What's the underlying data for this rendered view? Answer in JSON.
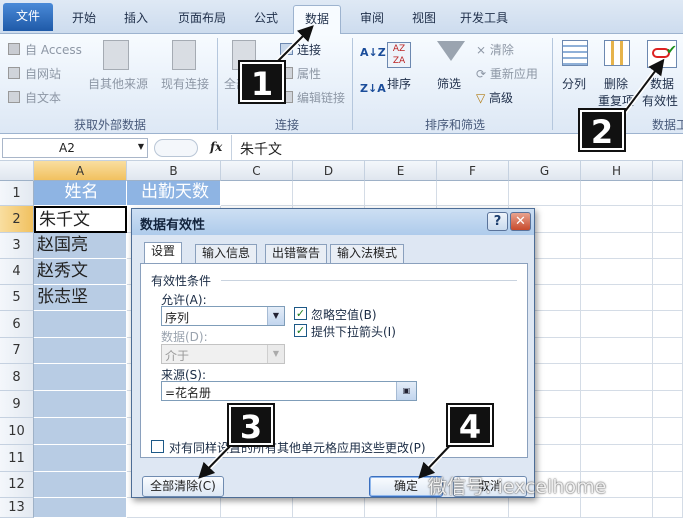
{
  "tabs": [
    "文件",
    "开始",
    "插入",
    "页面布局",
    "公式",
    "数据",
    "审阅",
    "视图",
    "开发工具"
  ],
  "ribbon": {
    "external": {
      "access": "自 Access",
      "web": "自网站",
      "text": "自文本",
      "other": "自其他来源",
      "existing": "现有连接",
      "group": "获取外部数据"
    },
    "connections": {
      "refresh": "全部",
      "conn": "连接",
      "props": "属性",
      "edit_links": "编辑链接",
      "group": "连接"
    },
    "sort": {
      "sort": "排序",
      "filter": "筛选",
      "clear": "清除",
      "reapply": "重新应用",
      "advanced": "高级",
      "group": "排序和筛选"
    },
    "tools": {
      "split": "分列",
      "remove": "删除",
      "duplicates": "重复项",
      "validation": "数据",
      "validity": "有效性",
      "group": "数据工"
    }
  },
  "formula_bar": {
    "name_box": "A2",
    "fx": "fx",
    "value": "朱千文"
  },
  "sheet": {
    "columns": [
      "A",
      "B",
      "C",
      "D",
      "E",
      "F",
      "G",
      "H"
    ],
    "rows": [
      "1",
      "2",
      "3",
      "4",
      "5",
      "6",
      "7",
      "8",
      "9",
      "10",
      "11",
      "12",
      "13"
    ],
    "header_a": "姓名",
    "header_b": "出勤天数",
    "names": [
      "朱千文",
      "赵国亮",
      "赵秀文",
      "张志坚"
    ]
  },
  "dialog": {
    "title": "数据有效性",
    "help": "?",
    "close": "✕",
    "tabs": [
      "设置",
      "输入信息",
      "出错警告",
      "输入法模式"
    ],
    "section": "有效性条件",
    "allow_label": "允许(A):",
    "allow_value": "序列",
    "data_label": "数据(D):",
    "data_value": "介于",
    "ignore_blank": "忽略空值(B)",
    "dropdown": "提供下拉箭头(I)",
    "source_label": "来源(S):",
    "source_value": "=花名册",
    "apply_all": "对有同样设置的所有其他单元格应用这些更改(P)",
    "clear_all": "全部清除(C)",
    "ok": "确定",
    "cancel": "取消"
  },
  "callouts": [
    "1",
    "2",
    "3",
    "4"
  ],
  "watermark": "微信号: iexcelhome",
  "colors": {
    "header_fill": "#8eb4e3",
    "column_fill": "#b8cce4",
    "ribbon_bg": "#dde8f5",
    "file_tab": "#1f5aa8"
  }
}
